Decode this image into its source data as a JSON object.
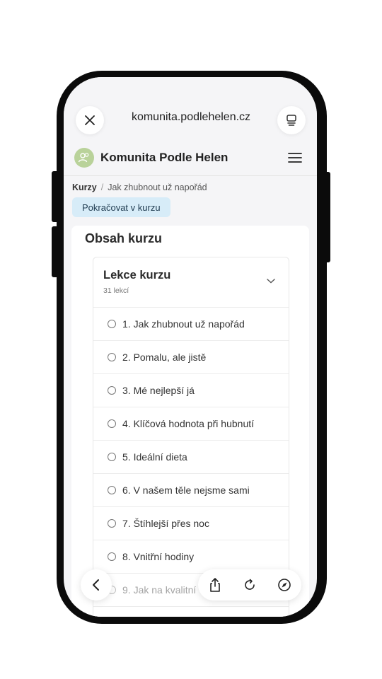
{
  "browser": {
    "url": "komunita.podlehelen.cz",
    "close_icon": "close-icon",
    "tabs_icon": "tab-overview-icon"
  },
  "site": {
    "title": "Komunita Podle Helen",
    "logo_icon": "community-avatar-icon",
    "menu_icon": "hamburger-menu-icon"
  },
  "breadcrumb": {
    "home": "Kurzy",
    "separator": "/",
    "current": "Jak zhubnout už napořád"
  },
  "continue_button": "Pokračovat v kurzu",
  "course_content": {
    "title": "Obsah kurzu",
    "lessons_title": "Lekce kurzu",
    "lessons_count": "31 lekcí",
    "lessons": [
      "1. Jak zhubnout už napořád",
      "2. Pomalu, ale jistě",
      "3. Mé nejlepší já",
      "4. Klíčová hodnota při hubnutí",
      "5. Ideální dieta",
      "6. V našem těle nejsme sami",
      "7. Štíhlejší přes noc",
      "8. Vnitřní hodiny",
      "9. Jak na kvalitní"
    ]
  },
  "toolbar": {
    "back_icon": "chevron-left-icon",
    "share_icon": "share-icon",
    "reload_icon": "reload-icon",
    "compass_icon": "compass-icon"
  },
  "colors": {
    "continue_bg": "#d7ecf8",
    "logo_bg": "#b9d29a"
  }
}
